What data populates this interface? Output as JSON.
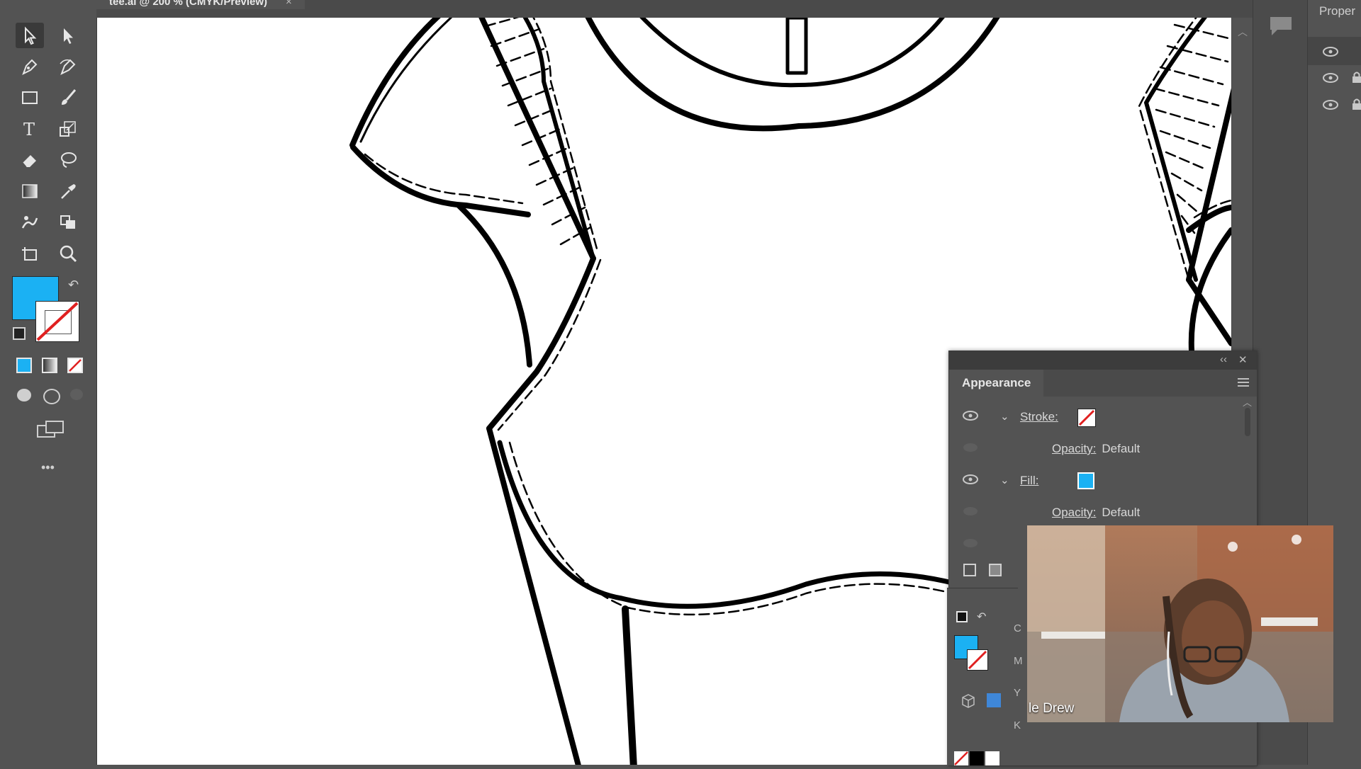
{
  "document": {
    "tab_title": "tee.ai @ 200 % (CMYK/Preview)",
    "close_symbol": "×"
  },
  "toolbar": {
    "tools": [
      {
        "name": "selection-tool-icon",
        "selected": true
      },
      {
        "name": "direct-selection-tool-icon"
      },
      {
        "name": "pen-tool-icon"
      },
      {
        "name": "curvature-tool-icon"
      },
      {
        "name": "rectangle-tool-icon"
      },
      {
        "name": "paintbrush-tool-icon"
      },
      {
        "name": "type-tool-icon"
      },
      {
        "name": "scale-tool-icon"
      },
      {
        "name": "eraser-tool-icon"
      },
      {
        "name": "lasso-tool-icon"
      },
      {
        "name": "gradient-tool-icon"
      },
      {
        "name": "eyedropper-tool-icon"
      },
      {
        "name": "puppet-warp-tool-icon"
      },
      {
        "name": "shape-builder-tool-icon"
      },
      {
        "name": "artboard-tool-icon"
      },
      {
        "name": "zoom-tool-icon"
      }
    ],
    "fill_color": "#1bb1f3",
    "stroke_color": "none",
    "more_label": "•••"
  },
  "appearance_panel": {
    "title": "Appearance",
    "collapse_symbol": "‹‹",
    "close_symbol": "✕",
    "rows": [
      {
        "label": "Stroke:",
        "swatch": "none"
      },
      {
        "sub_label": "Opacity:",
        "value": "Default"
      },
      {
        "label": "Fill:",
        "swatch": "#1bb1f3"
      },
      {
        "sub_label": "Opacity:",
        "value": "Default"
      }
    ]
  },
  "color_panel": {
    "letters": [
      "C",
      "M",
      "Y",
      "K"
    ],
    "fill_color": "#1bb1f3"
  },
  "properties_panel": {
    "title": "Proper"
  },
  "webcam": {
    "name_label": "le Drew"
  },
  "colors": {
    "ui_bg": "#535353",
    "accent": "#1bb1f3"
  }
}
